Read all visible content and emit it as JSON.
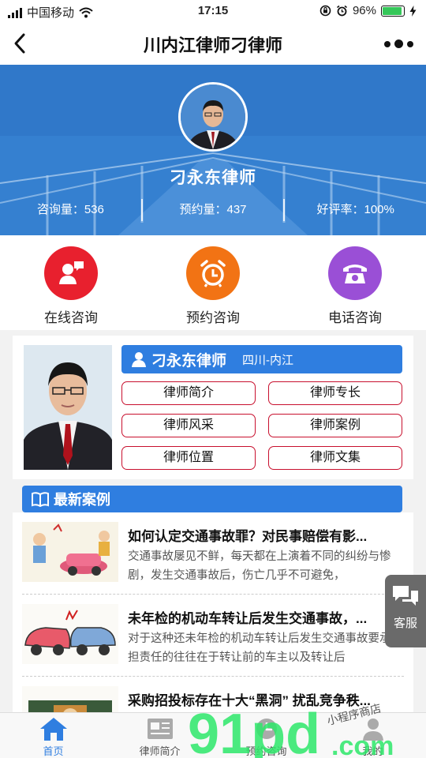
{
  "status_bar": {
    "carrier": "中国移动",
    "time": "17:15",
    "battery": "96%",
    "battery_level": 0.96
  },
  "nav": {
    "title": "川内江律师刁律师"
  },
  "profile": {
    "name": "刁永东律师",
    "stats": [
      {
        "label": "咨询量：536"
      },
      {
        "label": "预约量：437"
      },
      {
        "label": "好评率：100%"
      }
    ]
  },
  "actions": [
    {
      "label": "在线咨询",
      "icon": "chat-icon",
      "color": "#e8202e"
    },
    {
      "label": "预约咨询",
      "icon": "alarm-clock-icon",
      "color": "#f27314"
    },
    {
      "label": "电话咨询",
      "icon": "telephone-icon",
      "color": "#9a4fd6"
    }
  ],
  "card": {
    "name": "刁永东律师",
    "location": "四川-内江",
    "buttons": [
      "律师简介",
      "律师专长",
      "律师风采",
      "律师案例",
      "律师位置",
      "律师文集"
    ]
  },
  "cases": {
    "header": "最新案例",
    "items": [
      {
        "title": "如何认定交通事故罪？对民事赔偿有影...",
        "desc": "交通事故屡见不鲜，每天都在上演着不同的纠纷与惨剧，发生交通事故后，伤亡几乎不可避免，"
      },
      {
        "title": "未年检的机动车转让后发生交通事故，...",
        "desc": "对于这种还未年检的机动车转让后发生交通事故要承担责任的往往在于转让前的车主以及转让后"
      },
      {
        "title": "采购招投标存在十大“黑洞” 扰乱竞争秩...",
        "desc": ""
      }
    ]
  },
  "customer_service": {
    "label": "客服"
  },
  "tabs": [
    {
      "label": "首页",
      "active": true
    },
    {
      "label": "律师简介",
      "active": false
    },
    {
      "label": "预约咨询",
      "active": false
    },
    {
      "label": "我的",
      "active": false
    }
  ],
  "watermark": {
    "main": "91pd",
    "suffix": ".com",
    "script": "小程序商店"
  },
  "colors": {
    "primary": "#2f7ee0",
    "pill_border": "#c8102e",
    "active_tab": "#2f7ee0"
  }
}
